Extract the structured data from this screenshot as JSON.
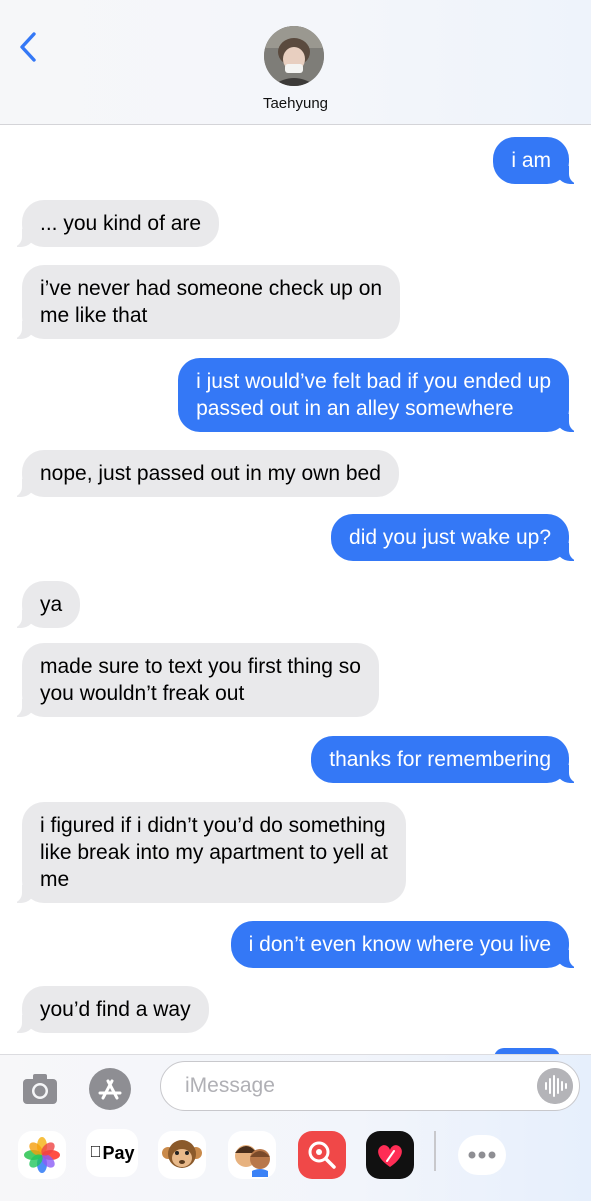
{
  "header": {
    "contact_name": "Taehyung"
  },
  "messages": [
    {
      "from": "me",
      "text": "i am"
    },
    {
      "from": "them",
      "text": "... you kind of are"
    },
    {
      "from": "them",
      "text": "i’ve never had someone check up on\nme like that"
    },
    {
      "from": "me",
      "text": "i just would’ve felt bad if you ended up\npassed out in an alley somewhere"
    },
    {
      "from": "them",
      "text": "nope, just passed out in my own bed"
    },
    {
      "from": "me",
      "text": "did you just wake up?"
    },
    {
      "from": "them",
      "text": "ya"
    },
    {
      "from": "them",
      "text": "made sure to text you first thing so\nyou wouldn’t freak out"
    },
    {
      "from": "me",
      "text": "thanks for remembering"
    },
    {
      "from": "them",
      "text": "i figured if i didn’t you’d do something\nlike break into my apartment to yell at\nme"
    },
    {
      "from": "me",
      "text": "i don’t even know where you live"
    },
    {
      "from": "them",
      "text": "you’d find a way"
    }
  ],
  "compose": {
    "placeholder": "iMessage"
  },
  "app_strip": {
    "apple_pay_label": "Pay"
  },
  "icons": {
    "back": "chevron-left-icon",
    "camera": "camera-icon",
    "app_store": "app-store-icon",
    "audio": "waveform-icon"
  },
  "colors": {
    "outgoing_bubble": "#3478f6",
    "incoming_bubble": "#e9e9eb",
    "accent": "#3478f6"
  }
}
